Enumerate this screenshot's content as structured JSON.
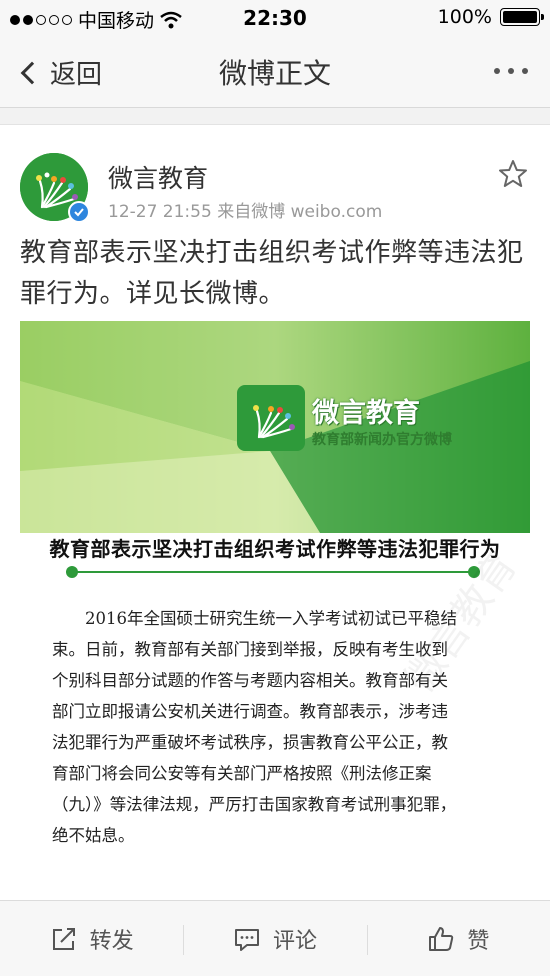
{
  "status_bar": {
    "carrier": "中国移动",
    "time": "22:30",
    "battery": "100%",
    "battery_level": 1.0
  },
  "nav": {
    "back_label": "返回",
    "title": "微博正文"
  },
  "post": {
    "author": "微言教育",
    "meta": "12-27 21:55  来自微博 weibo.com",
    "text": "教育部表示坚决打击组织考试作弊等违法犯罪行为。详见长微博。"
  },
  "image": {
    "logo_title": "微言教育",
    "logo_subtitle": "教育部新闻办官方微博",
    "article_title": "教育部表示坚决打击组织考试作弊等违法犯罪行为",
    "body_lines": [
      "　　2016年全国硕士研究生统一入学考试初试已平稳结",
      "束。日前，教育部有关部门接到举报，反映有考生收到",
      "个别科目部分试题的作答与考题内容相关。教育部有关",
      "部门立即报请公安机关进行调查。教育部表示，涉考违",
      "法犯罪行为严重破坏考试秩序，损害教育公平公正，教",
      "育部门将会同公安等有关部门严格按照《刑法修正案",
      "（九）》等法律法规，严厉打击国家教育考试刑事犯罪，",
      "绝不姑息。"
    ],
    "watermark": "微言教育"
  },
  "actions": {
    "repost": "转发",
    "comment": "评论",
    "like": "赞"
  },
  "colors": {
    "brand_green": "#2e9a3a",
    "verified_blue": "#2e86de"
  },
  "icons": [
    "back-chevron-icon",
    "more-icon",
    "star-icon",
    "verified-icon",
    "repost-icon",
    "comment-icon",
    "like-icon"
  ]
}
